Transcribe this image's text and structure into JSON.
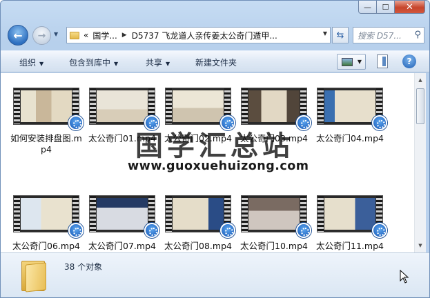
{
  "window": {
    "minimize_glyph": "—",
    "maximize_glyph": "☐",
    "close_glyph": "✕"
  },
  "nav": {
    "back_glyph": "←",
    "forward_glyph": "→",
    "breadcrumb_overflow": "«",
    "breadcrumb": [
      "国学...",
      "D5737 飞龙道人亲传姜太公奇门遁甲..."
    ],
    "search_placeholder": "搜索 D57..."
  },
  "toolbar": {
    "organize": "组织",
    "include_in_library": "包含到库中",
    "share": "共享",
    "new_folder": "新建文件夹",
    "help_glyph": "?"
  },
  "files": [
    {
      "name": "如何安装排盘图.mp4"
    },
    {
      "name": "太公奇门01.mp4"
    },
    {
      "name": "太公奇门02.mp4"
    },
    {
      "name": "太公奇门03.mp4"
    },
    {
      "name": "太公奇门04.mp4"
    },
    {
      "name": "太公奇门06.mp4"
    },
    {
      "name": "太公奇门07.mp4"
    },
    {
      "name": "太公奇门08.mp4"
    },
    {
      "name": "太公奇门10.mp4"
    },
    {
      "name": "太公奇门11.mp4"
    }
  ],
  "status": {
    "object_count": "38 个对象"
  },
  "watermark": {
    "title": "国学汇总站",
    "url": "www.guoxuehuizong.com"
  },
  "colors": {
    "accent": "#2d6fc0",
    "video_badge": "#1254b4",
    "close_button": "#c6452c"
  }
}
